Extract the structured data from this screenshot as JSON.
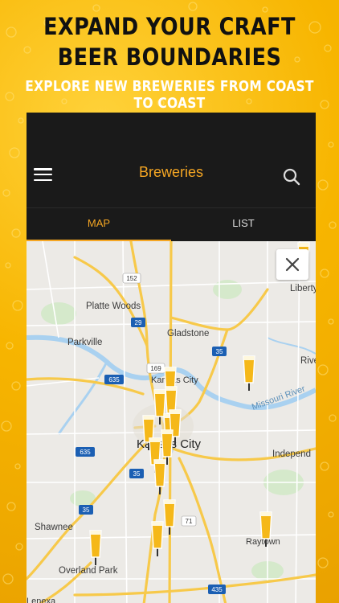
{
  "promo": {
    "title_line1": "EXPAND YOUR CRAFT",
    "title_line2": "BEER BOUNDARIES",
    "subtitle": "EXPLORE NEW BREWERIES FROM COAST TO COAST"
  },
  "appbar": {
    "title": "Breweries",
    "menu_icon": "hamburger-menu-icon",
    "search_icon": "search-icon"
  },
  "tabs": [
    {
      "label": "MAP",
      "active": true
    },
    {
      "label": "LIST",
      "active": false
    }
  ],
  "map": {
    "close_icon": "close-icon",
    "marker_icon": "beer-glass-icon",
    "labels": {
      "platte_woods": "Platte Woods",
      "parkville": "Parkville",
      "gladstone": "Gladstone",
      "liberty": "Liberty",
      "river": "River",
      "kansas_city": "Kansas City",
      "kansas_city_north": "Kansas City",
      "missouri_river": "Missouri River",
      "independence": "Independ",
      "shawnee": "Shawnee",
      "raytown": "Raytown",
      "overland_park": "Overland Park",
      "lenexa": "Lenexa"
    },
    "shields": {
      "r152": "152",
      "r29": "29",
      "r35a": "35",
      "r169": "169",
      "r635a": "635",
      "r635b": "635",
      "r35b": "35",
      "r35c": "35",
      "r71": "71",
      "r435": "435"
    }
  },
  "colors": {
    "accent": "#f5a623",
    "appbar": "#1a1a1a",
    "beer": "#f5b819"
  }
}
